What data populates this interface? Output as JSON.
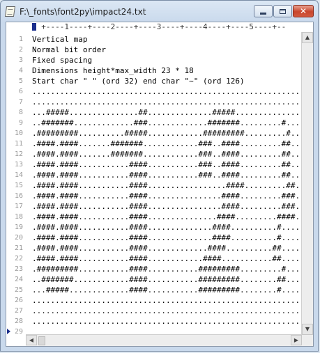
{
  "window": {
    "title": "F:\\_fonts\\font2py\\impact24.txt"
  },
  "ruler": {
    "text": "  +----1----+----2----+----3----+----4----+----5----+--"
  },
  "lines": [
    {
      "n": "1",
      "text": "Vertical map"
    },
    {
      "n": "2",
      "text": "Normal bit order"
    },
    {
      "n": "3",
      "text": "Fixed spacing"
    },
    {
      "n": "4",
      "text": "Dimensions height*max_width 23 * 18"
    },
    {
      "n": "5",
      "text": "Start char \" \" (ord 32) end char \"~\" (ord 126)"
    },
    {
      "n": "6",
      "text": ".............................................................."
    },
    {
      "n": "7",
      "text": ".............................................................."
    },
    {
      "n": "8",
      "text": "...#####...............##..............#####.................."
    },
    {
      "n": "9",
      "text": "..#######.............###.............#######.........#......."
    },
    {
      "n": "10",
      "text": ".#########..........#####............#########.........#......"
    },
    {
      "n": "11",
      "text": ".####.####.......#######............###..####.........##......"
    },
    {
      "n": "12",
      "text": ".####.####.......#######............###..####.........##......"
    },
    {
      "n": "13",
      "text": ".####.####...........####...........###..####.........##......"
    },
    {
      "n": "14",
      "text": ".####.####...........####...........###..####.........##......"
    },
    {
      "n": "15",
      "text": ".####.####...........####.................####.........##......"
    },
    {
      "n": "16",
      "text": ".####.####...........####................####.........###......"
    },
    {
      "n": "17",
      "text": ".####.####...........####................####.........###......"
    },
    {
      "n": "18",
      "text": ".####.####...........####...............####.........####......"
    },
    {
      "n": "19",
      "text": ".####.####...........####..............####..........#........."
    },
    {
      "n": "20",
      "text": ".####.####...........####..............####..........#........."
    },
    {
      "n": "21",
      "text": ".####.####...........####.............####..........##........."
    },
    {
      "n": "22",
      "text": ".####.####...........####............####...........##........."
    },
    {
      "n": "23",
      "text": ".#########...........####...........#########.........#........"
    },
    {
      "n": "24",
      "text": "..#######............####...........#########........##........"
    },
    {
      "n": "25",
      "text": "...#####.............####...........#########........#........."
    },
    {
      "n": "26",
      "text": ".............................................................."
    },
    {
      "n": "27",
      "text": ".............................................................."
    },
    {
      "n": "28",
      "text": ".............................................................."
    },
    {
      "n": "29",
      "text": ""
    }
  ],
  "scroll": {
    "up_icon": "arrow-up-icon",
    "down_icon": "arrow-down-icon",
    "left_icon": "arrow-left-icon",
    "right_icon": "arrow-right-icon"
  }
}
